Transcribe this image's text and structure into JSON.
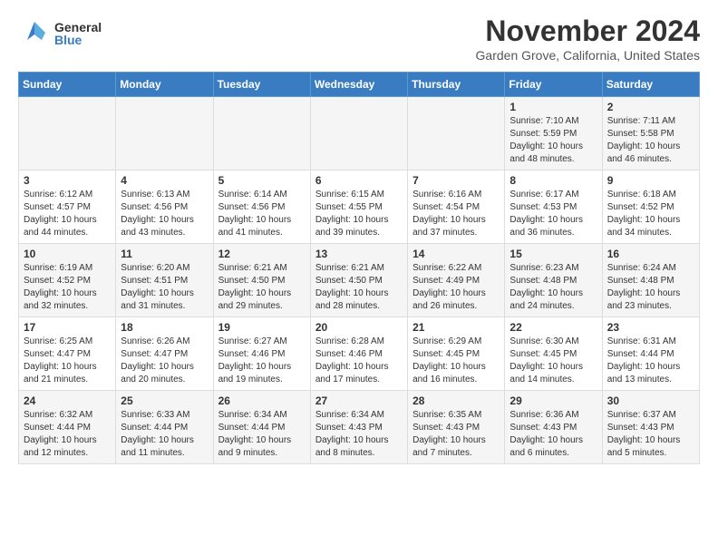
{
  "header": {
    "logo": {
      "general": "General",
      "blue": "Blue"
    },
    "month": "November 2024",
    "location": "Garden Grove, California, United States"
  },
  "weekdays": [
    "Sunday",
    "Monday",
    "Tuesday",
    "Wednesday",
    "Thursday",
    "Friday",
    "Saturday"
  ],
  "weeks": [
    [
      {
        "day": "",
        "info": ""
      },
      {
        "day": "",
        "info": ""
      },
      {
        "day": "",
        "info": ""
      },
      {
        "day": "",
        "info": ""
      },
      {
        "day": "",
        "info": ""
      },
      {
        "day": "1",
        "info": "Sunrise: 7:10 AM\nSunset: 5:59 PM\nDaylight: 10 hours\nand 48 minutes."
      },
      {
        "day": "2",
        "info": "Sunrise: 7:11 AM\nSunset: 5:58 PM\nDaylight: 10 hours\nand 46 minutes."
      }
    ],
    [
      {
        "day": "3",
        "info": "Sunrise: 6:12 AM\nSunset: 4:57 PM\nDaylight: 10 hours\nand 44 minutes."
      },
      {
        "day": "4",
        "info": "Sunrise: 6:13 AM\nSunset: 4:56 PM\nDaylight: 10 hours\nand 43 minutes."
      },
      {
        "day": "5",
        "info": "Sunrise: 6:14 AM\nSunset: 4:56 PM\nDaylight: 10 hours\nand 41 minutes."
      },
      {
        "day": "6",
        "info": "Sunrise: 6:15 AM\nSunset: 4:55 PM\nDaylight: 10 hours\nand 39 minutes."
      },
      {
        "day": "7",
        "info": "Sunrise: 6:16 AM\nSunset: 4:54 PM\nDaylight: 10 hours\nand 37 minutes."
      },
      {
        "day": "8",
        "info": "Sunrise: 6:17 AM\nSunset: 4:53 PM\nDaylight: 10 hours\nand 36 minutes."
      },
      {
        "day": "9",
        "info": "Sunrise: 6:18 AM\nSunset: 4:52 PM\nDaylight: 10 hours\nand 34 minutes."
      }
    ],
    [
      {
        "day": "10",
        "info": "Sunrise: 6:19 AM\nSunset: 4:52 PM\nDaylight: 10 hours\nand 32 minutes."
      },
      {
        "day": "11",
        "info": "Sunrise: 6:20 AM\nSunset: 4:51 PM\nDaylight: 10 hours\nand 31 minutes."
      },
      {
        "day": "12",
        "info": "Sunrise: 6:21 AM\nSunset: 4:50 PM\nDaylight: 10 hours\nand 29 minutes."
      },
      {
        "day": "13",
        "info": "Sunrise: 6:21 AM\nSunset: 4:50 PM\nDaylight: 10 hours\nand 28 minutes."
      },
      {
        "day": "14",
        "info": "Sunrise: 6:22 AM\nSunset: 4:49 PM\nDaylight: 10 hours\nand 26 minutes."
      },
      {
        "day": "15",
        "info": "Sunrise: 6:23 AM\nSunset: 4:48 PM\nDaylight: 10 hours\nand 24 minutes."
      },
      {
        "day": "16",
        "info": "Sunrise: 6:24 AM\nSunset: 4:48 PM\nDaylight: 10 hours\nand 23 minutes."
      }
    ],
    [
      {
        "day": "17",
        "info": "Sunrise: 6:25 AM\nSunset: 4:47 PM\nDaylight: 10 hours\nand 21 minutes."
      },
      {
        "day": "18",
        "info": "Sunrise: 6:26 AM\nSunset: 4:47 PM\nDaylight: 10 hours\nand 20 minutes."
      },
      {
        "day": "19",
        "info": "Sunrise: 6:27 AM\nSunset: 4:46 PM\nDaylight: 10 hours\nand 19 minutes."
      },
      {
        "day": "20",
        "info": "Sunrise: 6:28 AM\nSunset: 4:46 PM\nDaylight: 10 hours\nand 17 minutes."
      },
      {
        "day": "21",
        "info": "Sunrise: 6:29 AM\nSunset: 4:45 PM\nDaylight: 10 hours\nand 16 minutes."
      },
      {
        "day": "22",
        "info": "Sunrise: 6:30 AM\nSunset: 4:45 PM\nDaylight: 10 hours\nand 14 minutes."
      },
      {
        "day": "23",
        "info": "Sunrise: 6:31 AM\nSunset: 4:44 PM\nDaylight: 10 hours\nand 13 minutes."
      }
    ],
    [
      {
        "day": "24",
        "info": "Sunrise: 6:32 AM\nSunset: 4:44 PM\nDaylight: 10 hours\nand 12 minutes."
      },
      {
        "day": "25",
        "info": "Sunrise: 6:33 AM\nSunset: 4:44 PM\nDaylight: 10 hours\nand 11 minutes."
      },
      {
        "day": "26",
        "info": "Sunrise: 6:34 AM\nSunset: 4:44 PM\nDaylight: 10 hours\nand 9 minutes."
      },
      {
        "day": "27",
        "info": "Sunrise: 6:34 AM\nSunset: 4:43 PM\nDaylight: 10 hours\nand 8 minutes."
      },
      {
        "day": "28",
        "info": "Sunrise: 6:35 AM\nSunset: 4:43 PM\nDaylight: 10 hours\nand 7 minutes."
      },
      {
        "day": "29",
        "info": "Sunrise: 6:36 AM\nSunset: 4:43 PM\nDaylight: 10 hours\nand 6 minutes."
      },
      {
        "day": "30",
        "info": "Sunrise: 6:37 AM\nSunset: 4:43 PM\nDaylight: 10 hours\nand 5 minutes."
      }
    ]
  ]
}
